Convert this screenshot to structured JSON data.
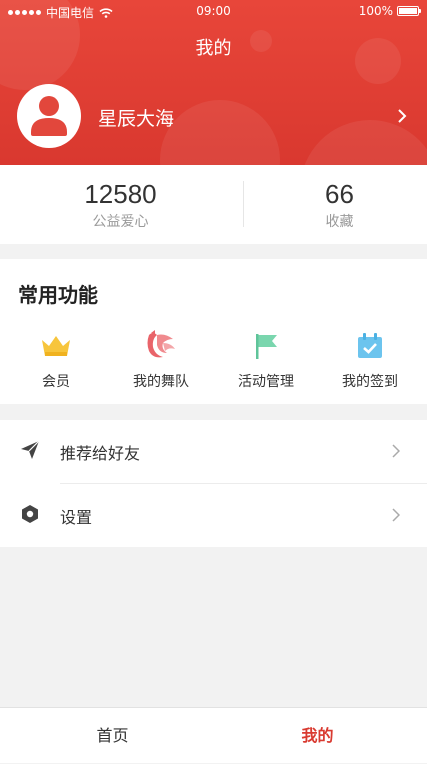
{
  "status_bar": {
    "carrier": "中国电信",
    "time": "09:00",
    "battery": "100%"
  },
  "header": {
    "title": "我的",
    "username": "星辰大海"
  },
  "stats": [
    {
      "value": "12580",
      "label": "公益爱心"
    },
    {
      "value": "66",
      "label": "收藏"
    }
  ],
  "functions": {
    "title": "常用功能",
    "items": [
      {
        "label": "会员",
        "icon": "crown-icon"
      },
      {
        "label": "我的舞队",
        "icon": "phoenix-icon"
      },
      {
        "label": "活动管理",
        "icon": "flag-icon"
      },
      {
        "label": "我的签到",
        "icon": "calendar-check-icon"
      }
    ]
  },
  "menu": [
    {
      "label": "推荐给好友",
      "icon": "send-icon"
    },
    {
      "label": "设置",
      "icon": "gear-icon"
    }
  ],
  "tabbar": {
    "home": "首页",
    "mine": "我的"
  },
  "colors": {
    "brand_red": "#d9382f",
    "active_tab": "#d93a30"
  }
}
